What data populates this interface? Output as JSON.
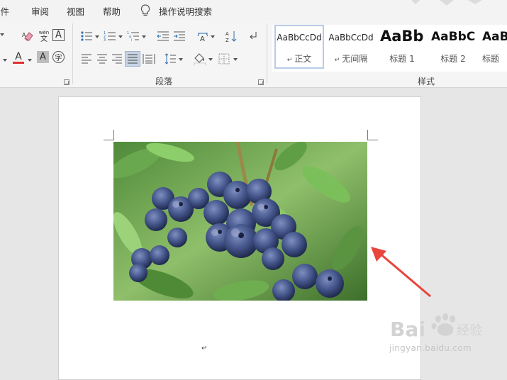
{
  "menu": {
    "items": [
      {
        "label": "邮件"
      },
      {
        "label": "审阅"
      },
      {
        "label": "视图"
      },
      {
        "label": "帮助"
      }
    ],
    "tell_me": "操作说明搜索"
  },
  "ribbon": {
    "font_group": {
      "phonetic_label": "wén",
      "phonetic_char": "文",
      "char_border": "A",
      "font_color": "A",
      "char_shading": "A",
      "enclose_char": "字",
      "font_color_value": "#e03030"
    },
    "paragraph_group": {
      "label": "段落"
    },
    "styles_group": {
      "label": "样式",
      "styles": [
        {
          "sample": "AaBbCcDd",
          "name": "正文",
          "selected": true
        },
        {
          "sample": "AaBbCcDd",
          "name": "无间隔",
          "selected": false
        },
        {
          "sample": "AaBb",
          "name": "标题 1",
          "selected": false
        },
        {
          "sample": "AaBbC",
          "name": "标题 2",
          "selected": false
        },
        {
          "sample": "AaB",
          "name": "标题",
          "selected": false
        }
      ]
    }
  },
  "document": {
    "image_subject": "blueberries-photo",
    "paragraph_mark": "↵"
  },
  "annotation": {
    "arrow_color": "#e8453c"
  },
  "watermark": {
    "brand": "Bai",
    "brand_suffix": "经验",
    "url": "jingyan.baidu.com"
  }
}
